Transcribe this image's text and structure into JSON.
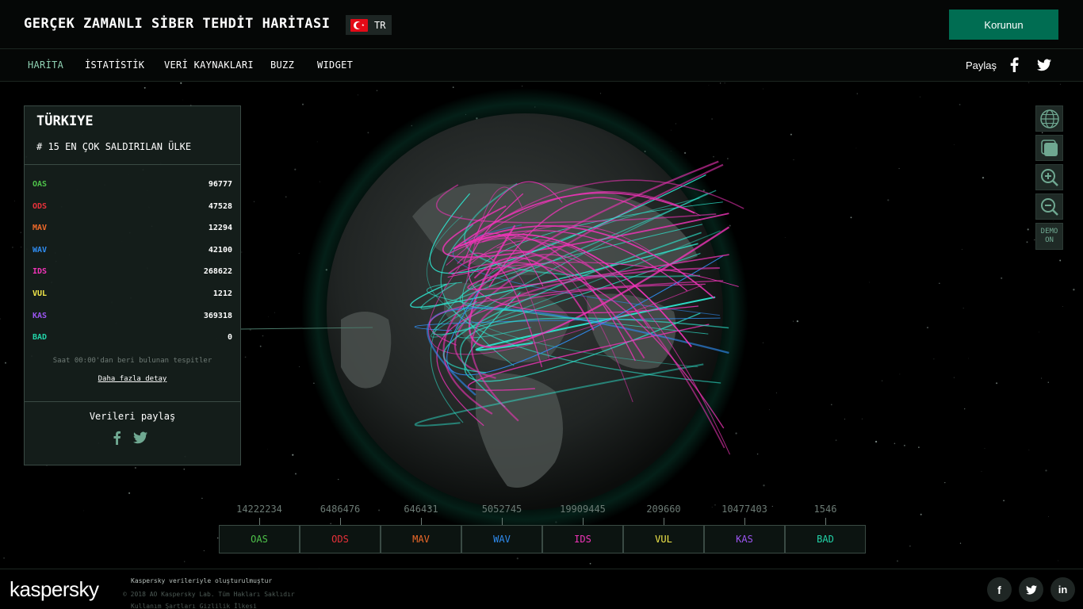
{
  "header": {
    "title": "GERÇEK ZAMANLI SİBER TEHDİT HARİTASI",
    "lang_code": "TR",
    "protect_button": "Korunun"
  },
  "nav": {
    "items": [
      "HARİTA",
      "İSTATİSTİK",
      "VERİ KAYNAKLARI",
      "BUZZ",
      "WIDGET"
    ],
    "active": "HARİTA",
    "share_label": "Paylaş"
  },
  "panel": {
    "country": "TÜRKIYE",
    "rank": "# 15 EN ÇOK SALDIRILAN ÜLKE",
    "stats": [
      {
        "label": "OAS",
        "value": "96777",
        "color": "#4ec24a"
      },
      {
        "label": "ODS",
        "value": "47528",
        "color": "#e8313a"
      },
      {
        "label": "MAV",
        "value": "12294",
        "color": "#f06a2a"
      },
      {
        "label": "WAV",
        "value": "42100",
        "color": "#2f8cf0"
      },
      {
        "label": "IDS",
        "value": "268622",
        "color": "#f034b8"
      },
      {
        "label": "VUL",
        "value": "1212",
        "color": "#f2e84a"
      },
      {
        "label": "KAS",
        "value": "369318",
        "color": "#9b55f0"
      },
      {
        "label": "BAD",
        "value": "0",
        "color": "#22d3a8"
      }
    ],
    "since_text": "Saat 00:00'dan beri bulunan tespitler",
    "more_link": "Daha fazla detay",
    "share_data": "Verileri paylaş"
  },
  "tools": {
    "demo_line1": "DEMO",
    "demo_line2": "ON"
  },
  "counters": [
    {
      "label": "OAS",
      "value": "14222234",
      "color": "#4ec24a"
    },
    {
      "label": "ODS",
      "value": "6486476",
      "color": "#e8313a"
    },
    {
      "label": "MAV",
      "value": "646431",
      "color": "#f06a2a"
    },
    {
      "label": "WAV",
      "value": "5052745",
      "color": "#2f8cf0"
    },
    {
      "label": "IDS",
      "value": "19909445",
      "color": "#f034b8"
    },
    {
      "label": "VUL",
      "value": "209660",
      "color": "#f2e84a"
    },
    {
      "label": "KAS",
      "value": "10477403",
      "color": "#9b55f0"
    },
    {
      "label": "BAD",
      "value": "1546",
      "color": "#22d3a8"
    }
  ],
  "footer": {
    "logo": "kaspersky",
    "line1": "Kaspersky verileriyle oluşturulmuştur",
    "line2": "© 2018 AO Kaspersky Lab. Tüm Hakları Saklıdır",
    "line3": "Kullanım Şartları Gizlilik İlkesi",
    "social": [
      "facebook-icon",
      "twitter-icon",
      "linkedin-icon"
    ]
  },
  "colors": {
    "accent": "#006d52",
    "globe_arcs_cyan": "#2ee6cf",
    "globe_arcs_magenta": "#f034b8"
  }
}
